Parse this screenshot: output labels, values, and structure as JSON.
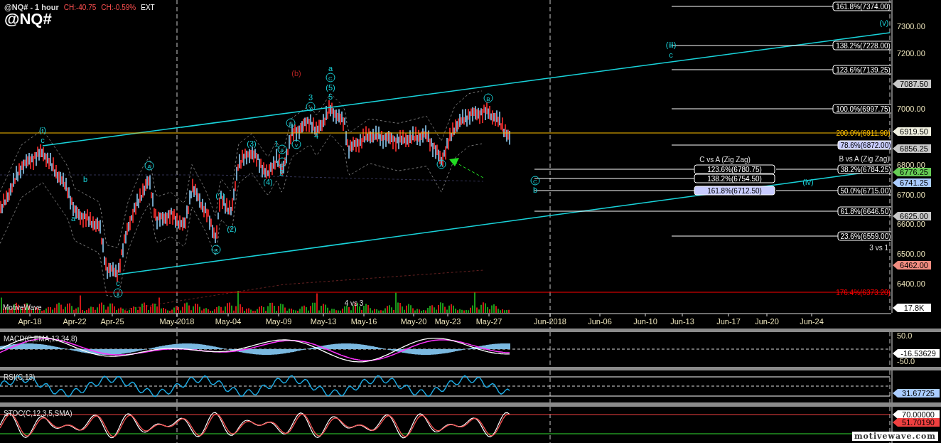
{
  "header": {
    "title": "@NQ# - 1 hour",
    "change": "CH:-40.75",
    "change_percent": "CH:-0.59%",
    "session": "EXT",
    "symbol": "@NQ#"
  },
  "price_chart": {
    "wave_labels": [
      {
        "text": "(i)",
        "kind": "plain"
      },
      {
        "text": "c",
        "kind": "plain"
      },
      {
        "text": "b",
        "kind": "plain"
      },
      {
        "text": "a",
        "kind": "plain"
      },
      {
        "text": "A",
        "kind": "circled"
      },
      {
        "text": "c",
        "kind": "plain"
      },
      {
        "text": "ii",
        "kind": "circled"
      },
      {
        "text": "B",
        "kind": "circled"
      },
      {
        "text": "(1)",
        "kind": "plain"
      },
      {
        "text": "(2)",
        "kind": "plain"
      },
      {
        "text": "(3)",
        "kind": "plain"
      },
      {
        "text": "(4)",
        "kind": "plain"
      },
      {
        "text": "1",
        "kind": "plain"
      },
      {
        "text": "ii",
        "kind": "circled"
      },
      {
        "text": "i",
        "kind": "circled"
      },
      {
        "text": "2",
        "kind": "plain"
      },
      {
        "text": "iii",
        "kind": "circled"
      },
      {
        "text": "v",
        "kind": "circled"
      },
      {
        "text": "3",
        "kind": "plain"
      },
      {
        "text": "v",
        "kind": "circled"
      },
      {
        "text": "4",
        "kind": "plain"
      },
      {
        "text": "(b)",
        "kind": "alternate"
      },
      {
        "text": "a",
        "kind": "plain"
      },
      {
        "text": "C",
        "kind": "circled"
      },
      {
        "text": "(5)",
        "kind": "plain"
      },
      {
        "text": "5",
        "kind": "plain"
      },
      {
        "text": "B",
        "kind": "circled"
      },
      {
        "text": "A",
        "kind": "circled"
      },
      {
        "text": "C",
        "kind": "circled"
      },
      {
        "text": "b",
        "kind": "plain"
      },
      {
        "text": "(iii)",
        "kind": "plain"
      },
      {
        "text": "c",
        "kind": "plain"
      },
      {
        "text": "(iv)",
        "kind": "plain"
      },
      {
        "text": "(v)",
        "kind": "plain"
      }
    ],
    "fib_levels": [
      {
        "label": "161.8%(7374.00)",
        "kind": "boxed"
      },
      {
        "label": "138.2%(7228.00)",
        "kind": "boxed"
      },
      {
        "label": "123.6%(7139.25)",
        "kind": "boxed"
      },
      {
        "label": "100.0%(6997.75)",
        "kind": "boxed"
      },
      {
        "label": "200.0%(6911.90)",
        "kind": "projection_line"
      },
      {
        "label": "78.6%(6872.00)",
        "kind": "highlighted"
      },
      {
        "label": "123.6%(6780.75)",
        "kind": "boxed"
      },
      {
        "label": "38.2%(6784.25)",
        "kind": "boxed"
      },
      {
        "label": "138.2%(6754.50)",
        "kind": "boxed"
      },
      {
        "label": "161.8%(6712.50)",
        "kind": "highlighted"
      },
      {
        "label": "50.0%(6715.00)",
        "kind": "boxed"
      },
      {
        "label": "61.8%(6646.50)",
        "kind": "boxed"
      },
      {
        "label": "23.6%(6559.00)",
        "kind": "boxed"
      },
      {
        "label": "176.4%(6373.20)",
        "kind": "extension_line"
      }
    ],
    "group_titles": [
      "C vs A (Zig Zag)",
      "B vs A (Zig Zag)"
    ],
    "notes": [
      "3 vs 1",
      "4 vs 3"
    ],
    "brand": "MotiveWave"
  },
  "price_axis": {
    "ticks": [
      "7300.00",
      "7200.00",
      "7000.00",
      "6800.00",
      "6700.00",
      "6600.00",
      "6500.00",
      "6400.00"
    ],
    "tags": [
      {
        "text": "7087.50",
        "color": "#c8c8c8"
      },
      {
        "text": "6919.50",
        "color": "#f0f0e0"
      },
      {
        "text": "6856.25",
        "color": "#c8c8c8"
      },
      {
        "text": "6776.25",
        "color": "#66cc55"
      },
      {
        "text": "6741.25",
        "color": "#aaccff"
      },
      {
        "text": "6625.00",
        "color": "#c8c8c8"
      },
      {
        "text": "6462.00",
        "color": "#f08c80"
      },
      {
        "text": "17.8K",
        "color": "#ffffff"
      }
    ]
  },
  "time_axis": {
    "labels": [
      "Apr-18",
      "Apr-22",
      "Apr-25",
      "May-2018",
      "May-04",
      "May-09",
      "May-13",
      "May-16",
      "May-20",
      "May-23",
      "May-27",
      "Jun-2018",
      "Jun-06",
      "Jun-10",
      "Jun-13",
      "Jun-17",
      "Jun-20",
      "Jun-24"
    ]
  },
  "indicators": [
    {
      "kind": "macd",
      "title": "MACD(C,EMA,13,34,8)",
      "ticks": [
        "50.0",
        "-50.0"
      ],
      "tags": [
        {
          "text": "-16.53629",
          "color": "#ffffff"
        }
      ]
    },
    {
      "kind": "rsi",
      "title": "RSI(C,13)",
      "tags": [
        {
          "text": "31.67725",
          "color": "#aaccff"
        }
      ]
    },
    {
      "kind": "stoch",
      "title": "STOC(C,12,3,5,SMA)",
      "tags": [
        {
          "text": "70.00000",
          "color": "#ffffff"
        },
        {
          "text": "51.70190",
          "color": "#f04040"
        }
      ]
    }
  ],
  "watermark": "motivewave.com"
}
